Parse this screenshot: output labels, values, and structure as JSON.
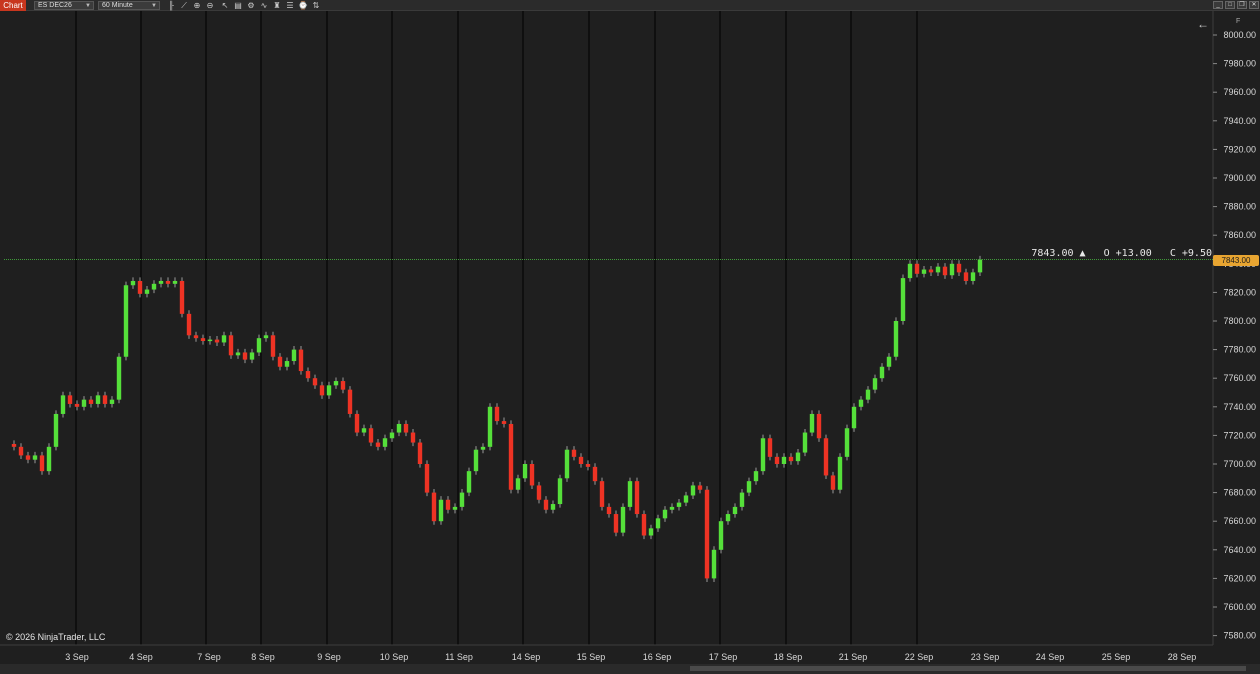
{
  "toolbar": {
    "tab_label": "Chart",
    "instrument": "ES DEC26",
    "interval": "60 Minute",
    "icons": [
      "bars-type-icon",
      "drawing-tool-icon",
      "zoom-in-icon",
      "zoom-out-icon",
      "select-cursor-icon",
      "data-box-icon",
      "properties-icon",
      "indicators-icon",
      "strategies-icon",
      "templates-icon",
      "time-frame-icon",
      "chart-trader-icon"
    ]
  },
  "window_controls": [
    "minimize-icon",
    "maximize-icon",
    "close-icon"
  ],
  "chart": {
    "copyright": "© 2026 NinjaTrader, LLC",
    "last_price_label": "7843.00",
    "readout": "7843.00 ▲   O +13.00   C +9.50"
  },
  "chart_data": {
    "type": "candlestick",
    "instrument": "ES DEC26",
    "interval": "60 Minute",
    "ylim": [
      7574,
      8012
    ],
    "y_ticks": [
      8000,
      7980,
      7960,
      7940,
      7920,
      7900,
      7880,
      7860,
      7840,
      7820,
      7800,
      7780,
      7760,
      7740,
      7720,
      7700,
      7680,
      7660,
      7640,
      7620,
      7600,
      7580
    ],
    "x_ticks": [
      "3 Sep",
      "4 Sep",
      "7 Sep",
      "8 Sep",
      "9 Sep",
      "10 Sep",
      "11 Sep",
      "14 Sep",
      "15 Sep",
      "16 Sep",
      "17 Sep",
      "18 Sep",
      "21 Sep",
      "22 Sep",
      "23 Sep",
      "24 Sep",
      "25 Sep",
      "28 Sep"
    ],
    "session_breaks": [
      "4 Sep",
      "7 Sep",
      "8 Sep",
      "9 Sep",
      "10 Sep",
      "11 Sep",
      "14 Sep",
      "15 Sep",
      "16 Sep",
      "17 Sep",
      "18 Sep",
      "21 Sep",
      "22 Sep"
    ],
    "last_price": 7843.0,
    "colors": {
      "up": "#55e03a",
      "down": "#ee3324",
      "wick": "#9a9a9a",
      "price_line": "#3f9a3a",
      "marker": "#e8a531",
      "session_line": "#000000"
    },
    "close_path": [
      [
        "2 Sep",
        7712
      ],
      [
        "2 Sep",
        7706
      ],
      [
        "2 Sep",
        7703
      ],
      [
        "2 Sep",
        7706
      ],
      [
        "2 Sep",
        7695
      ],
      [
        "2 Sep",
        7712
      ],
      [
        "2 Sep",
        7735
      ],
      [
        "3 Sep",
        7748
      ],
      [
        "3 Sep",
        7742
      ],
      [
        "3 Sep",
        7740
      ],
      [
        "3 Sep",
        7745
      ],
      [
        "3 Sep",
        7742
      ],
      [
        "3 Sep",
        7748
      ],
      [
        "3 Sep",
        7742
      ],
      [
        "3 Sep",
        7745
      ],
      [
        "3 Sep",
        7775
      ],
      [
        "3 Sep",
        7825
      ],
      [
        "4 Sep",
        7828
      ],
      [
        "4 Sep",
        7819
      ],
      [
        "4 Sep",
        7822
      ],
      [
        "4 Sep",
        7826
      ],
      [
        "4 Sep",
        7828
      ],
      [
        "4 Sep",
        7826
      ],
      [
        "4 Sep",
        7828
      ],
      [
        "4 Sep",
        7805
      ],
      [
        "4 Sep",
        7790
      ],
      [
        "7 Sep",
        7788
      ],
      [
        "7 Sep",
        7786
      ],
      [
        "7 Sep",
        7787
      ],
      [
        "7 Sep",
        7785
      ],
      [
        "7 Sep",
        7790
      ],
      [
        "7 Sep",
        7776
      ],
      [
        "8 Sep",
        7778
      ],
      [
        "8 Sep",
        7773
      ],
      [
        "8 Sep",
        7778
      ],
      [
        "8 Sep",
        7788
      ],
      [
        "8 Sep",
        7790
      ],
      [
        "8 Sep",
        7775
      ],
      [
        "8 Sep",
        7768
      ],
      [
        "8 Sep",
        7772
      ],
      [
        "9 Sep",
        7780
      ],
      [
        "9 Sep",
        7765
      ],
      [
        "9 Sep",
        7760
      ],
      [
        "9 Sep",
        7755
      ],
      [
        "9 Sep",
        7748
      ],
      [
        "9 Sep",
        7755
      ],
      [
        "9 Sep",
        7758
      ],
      [
        "9 Sep",
        7752
      ],
      [
        "9 Sep",
        7735
      ],
      [
        "9 Sep",
        7722
      ],
      [
        "10 Sep",
        7725
      ],
      [
        "10 Sep",
        7715
      ],
      [
        "10 Sep",
        7712
      ],
      [
        "10 Sep",
        7718
      ],
      [
        "10 Sep",
        7722
      ],
      [
        "10 Sep",
        7728
      ],
      [
        "10 Sep",
        7722
      ],
      [
        "10 Sep",
        7715
      ],
      [
        "10 Sep",
        7700
      ],
      [
        "10 Sep",
        7680
      ],
      [
        "11 Sep",
        7660
      ],
      [
        "11 Sep",
        7675
      ],
      [
        "11 Sep",
        7668
      ],
      [
        "11 Sep",
        7670
      ],
      [
        "11 Sep",
        7680
      ],
      [
        "11 Sep",
        7695
      ],
      [
        "11 Sep",
        7710
      ],
      [
        "11 Sep",
        7712
      ],
      [
        "11 Sep",
        7740
      ],
      [
        "11 Sep",
        7730
      ],
      [
        "14 Sep",
        7728
      ],
      [
        "14 Sep",
        7682
      ],
      [
        "14 Sep",
        7690
      ],
      [
        "14 Sep",
        7700
      ],
      [
        "14 Sep",
        7685
      ],
      [
        "14 Sep",
        7675
      ],
      [
        "14 Sep",
        7668
      ],
      [
        "14 Sep",
        7672
      ],
      [
        "14 Sep",
        7690
      ],
      [
        "14 Sep",
        7710
      ],
      [
        "15 Sep",
        7705
      ],
      [
        "15 Sep",
        7700
      ],
      [
        "15 Sep",
        7698
      ],
      [
        "15 Sep",
        7688
      ],
      [
        "15 Sep",
        7670
      ],
      [
        "15 Sep",
        7665
      ],
      [
        "15 Sep",
        7652
      ],
      [
        "15 Sep",
        7670
      ],
      [
        "15 Sep",
        7688
      ],
      [
        "15 Sep",
        7665
      ],
      [
        "16 Sep",
        7650
      ],
      [
        "16 Sep",
        7655
      ],
      [
        "16 Sep",
        7662
      ],
      [
        "16 Sep",
        7668
      ],
      [
        "16 Sep",
        7670
      ],
      [
        "16 Sep",
        7673
      ],
      [
        "16 Sep",
        7678
      ],
      [
        "16 Sep",
        7685
      ],
      [
        "16 Sep",
        7682
      ],
      [
        "16 Sep",
        7620
      ],
      [
        "17 Sep",
        7640
      ],
      [
        "17 Sep",
        7660
      ],
      [
        "17 Sep",
        7665
      ],
      [
        "17 Sep",
        7670
      ],
      [
        "17 Sep",
        7680
      ],
      [
        "17 Sep",
        7688
      ],
      [
        "17 Sep",
        7695
      ],
      [
        "17 Sep",
        7718
      ],
      [
        "17 Sep",
        7705
      ],
      [
        "18 Sep",
        7700
      ],
      [
        "18 Sep",
        7705
      ],
      [
        "18 Sep",
        7702
      ],
      [
        "18 Sep",
        7708
      ],
      [
        "18 Sep",
        7722
      ],
      [
        "18 Sep",
        7735
      ],
      [
        "18 Sep",
        7718
      ],
      [
        "18 Sep",
        7692
      ],
      [
        "18 Sep",
        7682
      ],
      [
        "21 Sep",
        7705
      ],
      [
        "21 Sep",
        7725
      ],
      [
        "21 Sep",
        7740
      ],
      [
        "21 Sep",
        7745
      ],
      [
        "21 Sep",
        7752
      ],
      [
        "21 Sep",
        7760
      ],
      [
        "21 Sep",
        7768
      ],
      [
        "21 Sep",
        7775
      ],
      [
        "21 Sep",
        7800
      ],
      [
        "21 Sep",
        7830
      ],
      [
        "22 Sep",
        7840
      ],
      [
        "22 Sep",
        7833
      ],
      [
        "22 Sep",
        7836
      ],
      [
        "22 Sep",
        7834
      ],
      [
        "22 Sep",
        7838
      ],
      [
        "22 Sep",
        7832
      ],
      [
        "22 Sep",
        7840
      ],
      [
        "22 Sep",
        7834
      ],
      [
        "22 Sep",
        7828
      ],
      [
        "22 Sep",
        7834
      ],
      [
        "22 Sep",
        7843
      ]
    ]
  }
}
